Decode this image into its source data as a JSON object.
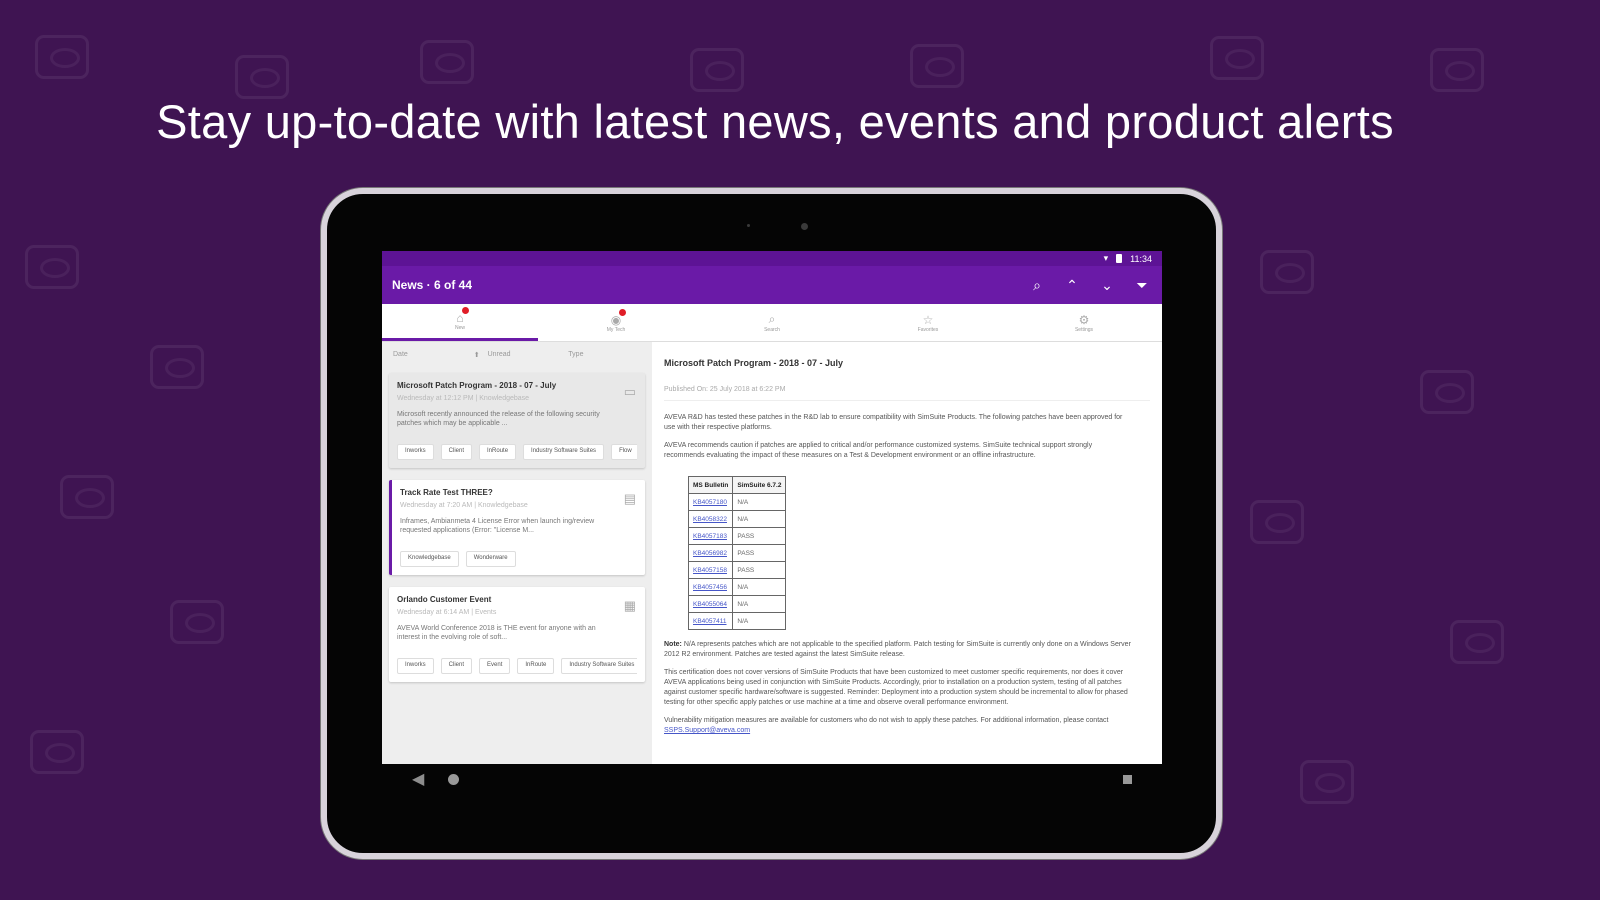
{
  "headline": "Stay up-to-date with latest news, events and product alerts",
  "status": {
    "time": "11:34"
  },
  "app": {
    "title": "News · 6 of 44",
    "actions": [
      "search-icon",
      "up-arrow-icon",
      "down-arrow-icon",
      "filter-icon"
    ]
  },
  "tabs": [
    {
      "label": "New",
      "icon": "home-icon",
      "active": true,
      "badge": true
    },
    {
      "label": "My Tech",
      "icon": "user-icon",
      "active": false,
      "badge": true
    },
    {
      "label": "Search",
      "icon": "search-icon",
      "active": false,
      "badge": false
    },
    {
      "label": "Favorites",
      "icon": "star-icon",
      "active": false,
      "badge": false
    },
    {
      "label": "Settings",
      "icon": "settings-icon",
      "active": false,
      "badge": false
    }
  ],
  "filters": {
    "date": "Date",
    "unread": "Unread",
    "type": "Type"
  },
  "cards": [
    {
      "title": "Microsoft Patch Program - 2018 - 07 - July",
      "meta": "Wednesday at 12:12 PM | Knowledgebase",
      "body": "Microsoft recently announced the release of the following security patches which may be applicable ...",
      "tags": [
        "Inworks",
        "Client",
        "InRoute",
        "Industry Software Suites",
        "Flow"
      ],
      "icon": "document-icon"
    },
    {
      "title": "Track Rate Test THREE?",
      "meta": "Wednesday at 7:20 AM | Knowledgebase",
      "body": "Inframes, Ambianmeta 4 License Error when launch ing/review requested applications (Error: \"License M...",
      "tags": [
        "Knowledgebase",
        "Wonderware"
      ],
      "icon": "document-icon"
    },
    {
      "title": "Orlando Customer Event",
      "meta": "Wednesday at 6:14 AM | Events",
      "body": "AVEVA World Conference 2018 is THE event for anyone with an interest in the evolving role of soft...",
      "tags": [
        "Inworks",
        "Client",
        "Event",
        "InRoute",
        "Industry Software Suites"
      ],
      "icon": "calendar-icon"
    }
  ],
  "detail": {
    "title": "Microsoft Patch Program - 2018 - 07 - July",
    "published": "Published On: 25 July 2018 at 6:22 PM",
    "p1": "AVEVA R&D has tested these patches in the R&D lab to ensure compatibility with SimSuite Products. The following patches have been approved for use with their respective platforms.",
    "p2": "AVEVA recommends caution if patches are applied to critical and/or performance customized systems. SimSuite technical support strongly recommends evaluating the impact of these measures on a Test & Development environment or an offline infrastructure.",
    "table": {
      "headers": [
        "MS Bulletin",
        "SimSuite 6.7.2"
      ],
      "rows": [
        [
          "KB4057180",
          "N/A"
        ],
        [
          "KB4058322",
          "N/A"
        ],
        [
          "KB4057183",
          "PASS"
        ],
        [
          "KB4056982",
          "PASS"
        ],
        [
          "KB4057158",
          "PASS"
        ],
        [
          "KB4057456",
          "N/A"
        ],
        [
          "KB4055064",
          "N/A"
        ],
        [
          "KB4057411",
          "N/A"
        ]
      ]
    },
    "note_label": "Note:",
    "note": "N/A represents patches which are not applicable to the specified platform. Patch testing for SimSuite is currently only done on a Windows Server 2012 R2 environment. Patches are tested against the latest SimSuite release.",
    "p3": "This certification does not cover versions of SimSuite Products that have been customized to meet customer specific requirements, nor does it cover AVEVA applications being used in conjunction with SimSuite Products. Accordingly, prior to installation on a production system, testing of all patches against customer specific hardware/software is suggested. Reminder: Deployment into a production system should be incremental to allow for phased testing for other specific apply patches or use machine at a time and observe overall performance environment.",
    "p4": "Vulnerability mitigation measures are available for customers who do not wish to apply these patches. For additional information, please contact",
    "email": "SSPS.Support@aveva.com"
  }
}
